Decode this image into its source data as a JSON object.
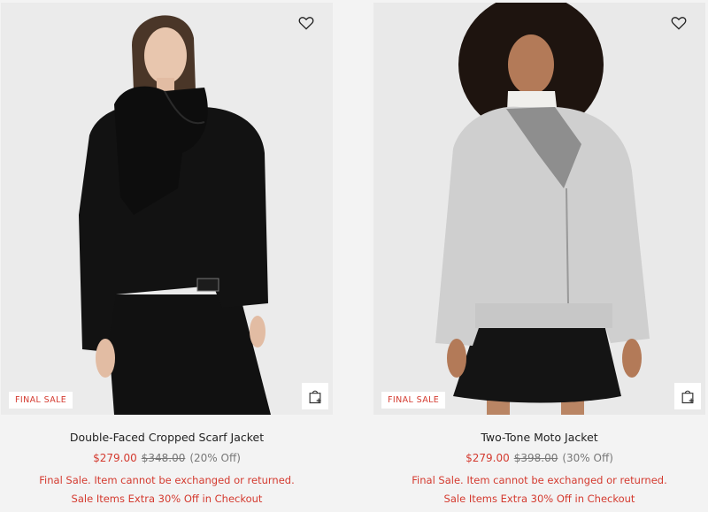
{
  "products": [
    {
      "name": "Double-Faced Cropped Scarf Jacket",
      "badge": "FINAL SALE",
      "sale_price": "$279.00",
      "original_price": "$348.00",
      "discount": "(20% Off)",
      "final_sale_note": "Final Sale. Item cannot be exchanged or returned.",
      "promo_note": "Sale Items Extra 30% Off in Checkout"
    },
    {
      "name": "Two-Tone Moto Jacket",
      "badge": "FINAL SALE",
      "sale_price": "$279.00",
      "original_price": "$398.00",
      "discount": "(30% Off)",
      "final_sale_note": "Final Sale. Item cannot be exchanged or returned.",
      "promo_note": "Sale Items Extra 30% Off in Checkout"
    }
  ],
  "icons": {
    "favorite": "heart-icon",
    "quick_add": "shopping-bag-plus-icon"
  },
  "colors": {
    "sale_red": "#d43a2f",
    "muted_gray": "#777777",
    "background": "#f3f3f3"
  }
}
